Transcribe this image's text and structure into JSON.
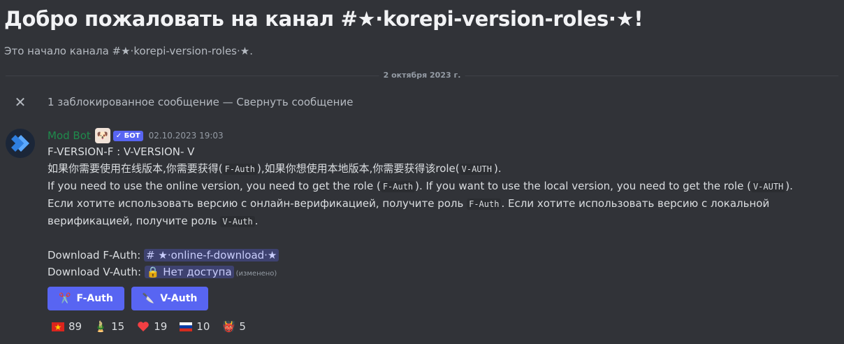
{
  "channel": {
    "welcome_title": "Добро пожаловать на канал #★·korepi-version-roles·★!",
    "welcome_sub": "Это начало канала #★·korepi-version-roles·★."
  },
  "date_divider": "2 октября 2023 г.",
  "blocked": {
    "text": "1 заблокированное сообщение — ",
    "collapse": "Свернуть сообщение"
  },
  "message": {
    "author": "Mod Bot",
    "bot_tag": "✓ БОТ",
    "timestamp": "02.10.2023 19:03",
    "line1": "F-VERSION-F : V-VERSION- V",
    "zh_a": "如果你需要使用在线版本,你需要获得(",
    "zh_code1": "F-Auth",
    "zh_b": "),如果你想使用本地版本,你需要获得该role(",
    "zh_code2": "V-AUTH",
    "zh_c": ").",
    "en_a": "If you need to use the online version, you need to get the role (",
    "en_code1": "F-Auth",
    "en_b": "). If you want to use the local version, you need to get the role (",
    "en_code2": "V-AUTH",
    "en_c": ").",
    "ru_a": "Если хотите использовать версию с онлайн-верификацией, получите роль ",
    "ru_code1": "F-Auth",
    "ru_b": ". Если хотите использовать версию с локальной верификацией, получите роль ",
    "ru_code2": "V-Auth",
    "ru_c": ".",
    "dl_f_label": "Download F-Auth: ",
    "dl_f_channel": "# ★·online-f-download·★",
    "dl_v_label": "Download V-Auth: ",
    "dl_v_channel": "🔒 Нет доступа",
    "edited": "(изменено)"
  },
  "buttons": [
    {
      "label": "F-Auth",
      "icon": "scissors-icon",
      "emoji": "✂️"
    },
    {
      "label": "V-Auth",
      "icon": "knife-icon",
      "emoji": "🔪"
    }
  ],
  "reactions": [
    {
      "emoji": "🇻🇳",
      "count": "89",
      "icon": "vietnam-flag-icon"
    },
    {
      "emoji": "🎍",
      "count": "15",
      "icon": "bamboo-icon"
    },
    {
      "emoji": "❤️",
      "count": "19",
      "icon": "heart-icon"
    },
    {
      "emoji": "🇷🇺",
      "count": "10",
      "icon": "russia-flag-icon"
    },
    {
      "emoji": "👹",
      "count": "5",
      "icon": "ogre-icon"
    }
  ],
  "colors": {
    "background": "#313338",
    "blurple": "#5865f2",
    "author": "#1f8b4c"
  }
}
